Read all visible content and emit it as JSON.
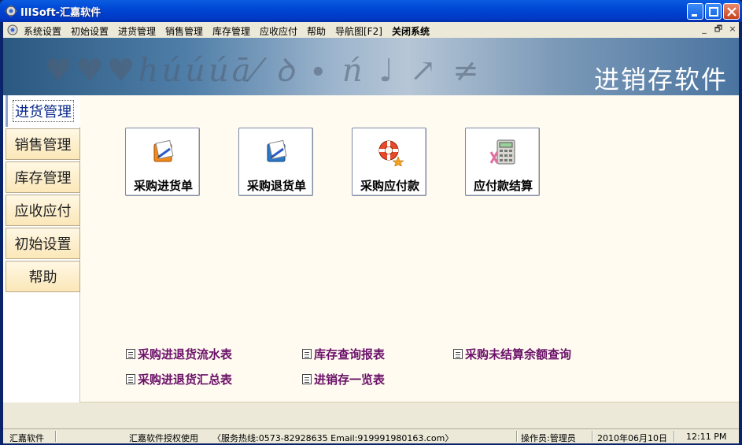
{
  "window": {
    "title": "IIISoft-汇嘉软件"
  },
  "menu": {
    "items": [
      "系统设置",
      "初始设置",
      "进货管理",
      "销售管理",
      "库存管理",
      "应收应付",
      "帮助",
      "导航图[F2]",
      "关闭系统"
    ],
    "mdi_buttons": [
      "_",
      "🗗",
      "×"
    ]
  },
  "banner": {
    "title": "进销存软件",
    "decoration": "♥♥♥húúúā⁄ ꝺ ∙ ń ♩ ↗ ≠"
  },
  "sidebar": {
    "items": [
      {
        "label": "进货管理",
        "active": true
      },
      {
        "label": "销售管理",
        "active": false
      },
      {
        "label": "库存管理",
        "active": false
      },
      {
        "label": "应收应付",
        "active": false
      },
      {
        "label": "初始设置",
        "active": false
      },
      {
        "label": "帮助",
        "active": false
      }
    ]
  },
  "functions": [
    {
      "label": "采购进货单",
      "icon": "purchase-order-icon"
    },
    {
      "label": "采购退货单",
      "icon": "purchase-return-icon"
    },
    {
      "label": "采购应付款",
      "icon": "payable-lifebuoy-icon"
    },
    {
      "label": "应付款结算",
      "icon": "calculator-icon"
    }
  ],
  "reports": [
    {
      "label": "采购进退货流水表"
    },
    {
      "label": "库存查询报表"
    },
    {
      "label": "采购未结算余额查询"
    },
    {
      "label": "采购进退货汇总表"
    },
    {
      "label": "进销存一览表"
    }
  ],
  "status": {
    "company": "汇嘉软件",
    "license": "汇嘉软件授权使用",
    "contact": "〈服务热线:0573-82928635  Email:919991980163.com〉",
    "operator": "操作员:管理员",
    "date": "2010年06月10日",
    "time": "12:11 PM"
  },
  "colors": {
    "title_bar": "#0047d6",
    "link": "#6a1068",
    "sidebar_tab": "#fbe7b8",
    "content_bg": "#fffbf0"
  }
}
